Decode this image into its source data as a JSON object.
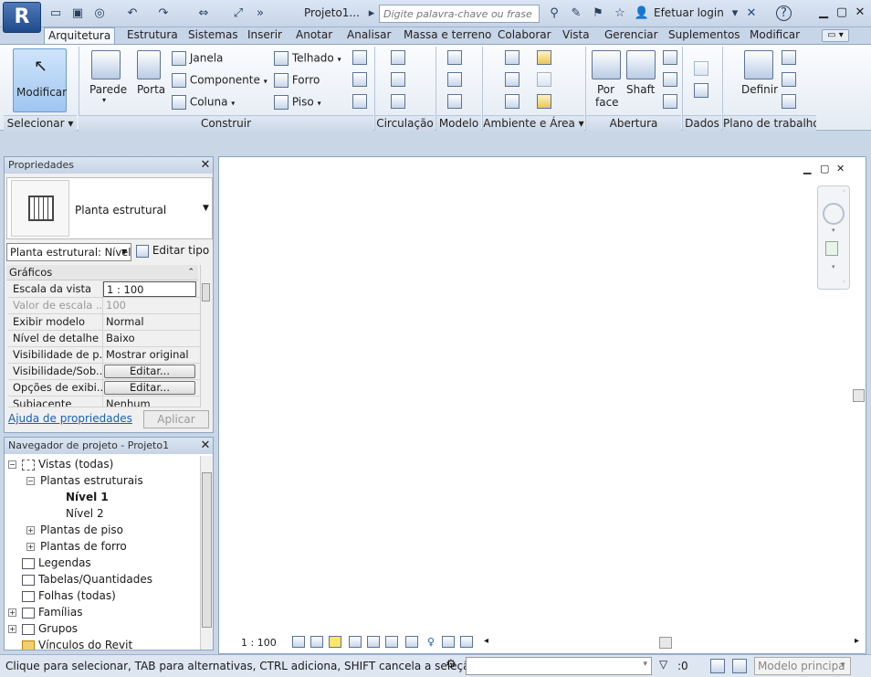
{
  "title_bar": {
    "app_logo": "R",
    "doc_title": "Projeto1...",
    "search_placeholder": "Digite palavra-chave ou frase",
    "login_label": "Efetuar login",
    "help_label": "?"
  },
  "tabs": [
    "Arquitetura",
    "Estrutura",
    "Sistemas",
    "Inserir",
    "Anotar",
    "Analisar",
    "Massa e terreno",
    "Colaborar",
    "Vista",
    "Gerenciar",
    "Suplementos",
    "Modificar"
  ],
  "ribbon": {
    "modificar": "Modificar",
    "parede": "Parede",
    "porta": "Porta",
    "janela": "Janela",
    "componente": "Componente",
    "coluna": "Coluna",
    "telhado": "Telhado",
    "forro": "Forro",
    "piso": "Piso",
    "por_face_1": "Por",
    "por_face_2": "face",
    "shaft": "Shaft",
    "definir": "Definir",
    "panels": {
      "selecionar": "Selecionar",
      "construir": "Construir",
      "circulacao": "Circulação",
      "modelo": "Modelo",
      "ambiente": "Ambiente e Área",
      "abertura": "Abertura",
      "dados": "Dados",
      "plano": "Plano de trabalho"
    }
  },
  "properties": {
    "title": "Propriedades",
    "type_name": "Planta estrutural",
    "instance_select": "Planta estrutural: Nível",
    "edit_type": "Editar tipo",
    "group": "Gráficos",
    "rows": [
      {
        "k": "Escala da vista",
        "v": "1 : 100"
      },
      {
        "k": "Valor de escala ...",
        "v": "100"
      },
      {
        "k": "Exibir modelo",
        "v": "Normal"
      },
      {
        "k": "Nível de detalhe",
        "v": "Baixo"
      },
      {
        "k": "Visibilidade de p...",
        "v": "Mostrar original"
      },
      {
        "k": "Visibilidade/Sob...",
        "v": "Editar..."
      },
      {
        "k": "Opções de exibi...",
        "v": "Editar..."
      },
      {
        "k": "Subjacente",
        "v": "Nenhum"
      }
    ],
    "help_link": "Ajuda de propriedades",
    "apply": "Aplicar"
  },
  "navigator": {
    "title": "Navegador de projeto - Projeto1",
    "items": [
      {
        "label": "Vistas (todas)"
      },
      {
        "label": "Plantas estruturais"
      },
      {
        "label": "Nível 1"
      },
      {
        "label": "Nível 2"
      },
      {
        "label": "Plantas de piso"
      },
      {
        "label": "Plantas de forro"
      },
      {
        "label": "Legendas"
      },
      {
        "label": "Tabelas/Quantidades"
      },
      {
        "label": "Folhas (todas)"
      },
      {
        "label": "Famílias"
      },
      {
        "label": "Grupos"
      },
      {
        "label": "Vínculos do Revit"
      }
    ]
  },
  "view_bar": {
    "scale": "1 : 100"
  },
  "status": {
    "message": "Clique para selecionar, TAB para alternativas, CTRL adiciona, SHIFT cancela a seleção.",
    "filter_count": ":0",
    "model": "Modelo principa"
  },
  "colors": {
    "accent": "#1f4a8c",
    "selected": "#9fc6f0",
    "link": "#1a5fb4"
  }
}
